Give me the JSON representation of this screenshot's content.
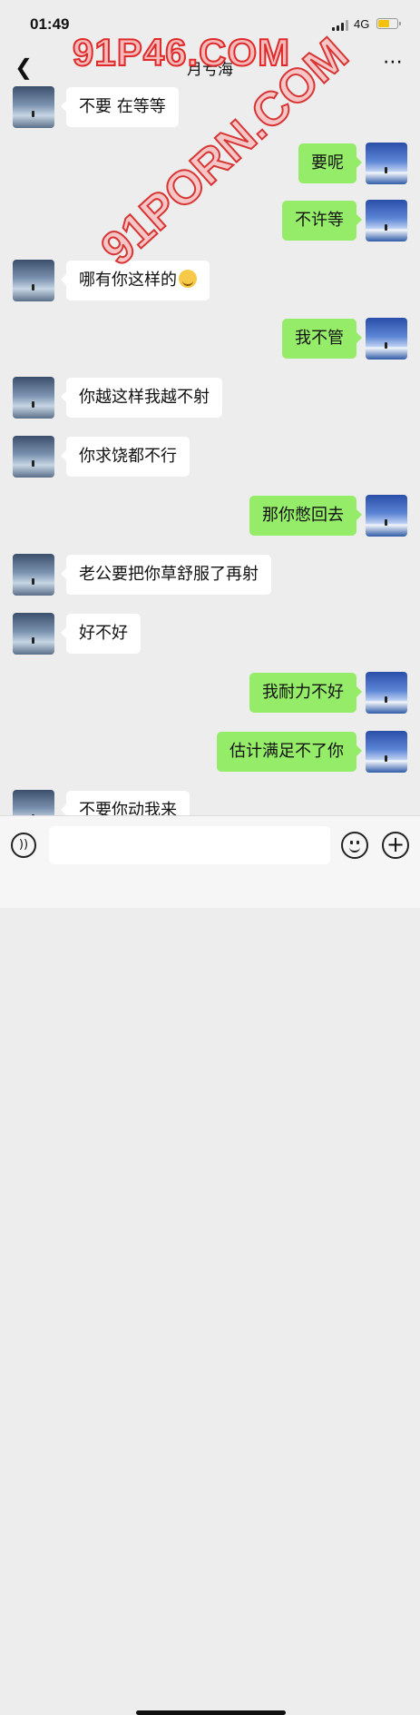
{
  "status_bar": {
    "time": "01:49",
    "network": "4G"
  },
  "nav": {
    "back_icon": "chevron-left-icon",
    "title": "月亏海",
    "more_icon": "more-dots-icon"
  },
  "watermarks": [
    "91P46.COM",
    "91PORN.COM"
  ],
  "messages": [
    {
      "side": "left",
      "text": "不要 在等等"
    },
    {
      "side": "right",
      "text": "要呢"
    },
    {
      "side": "right",
      "text": "不许等"
    },
    {
      "side": "left",
      "text": "哪有你这样的",
      "emoji": "laughing-emoji-icon"
    },
    {
      "side": "right",
      "text": "我不管"
    },
    {
      "side": "left",
      "text": "你越这样我越不射"
    },
    {
      "side": "left",
      "text": "你求饶都不行"
    },
    {
      "side": "right",
      "text": "那你憋回去"
    },
    {
      "side": "left",
      "text": "老公要把你草舒服了再射"
    },
    {
      "side": "left",
      "text": "好不好"
    },
    {
      "side": "right",
      "text": "我耐力不好"
    },
    {
      "side": "right",
      "text": "估计满足不了你"
    },
    {
      "side": "left",
      "text": "不要你动我来"
    }
  ],
  "input_bar": {
    "voice_icon": "voice-icon",
    "placeholder": "",
    "emoji_icon": "smiley-icon",
    "plus_icon": "plus-icon"
  },
  "colors": {
    "background": "#ededed",
    "bubble_self": "#95ec69",
    "bubble_other": "#ffffff",
    "watermark": "#e02a2a"
  }
}
